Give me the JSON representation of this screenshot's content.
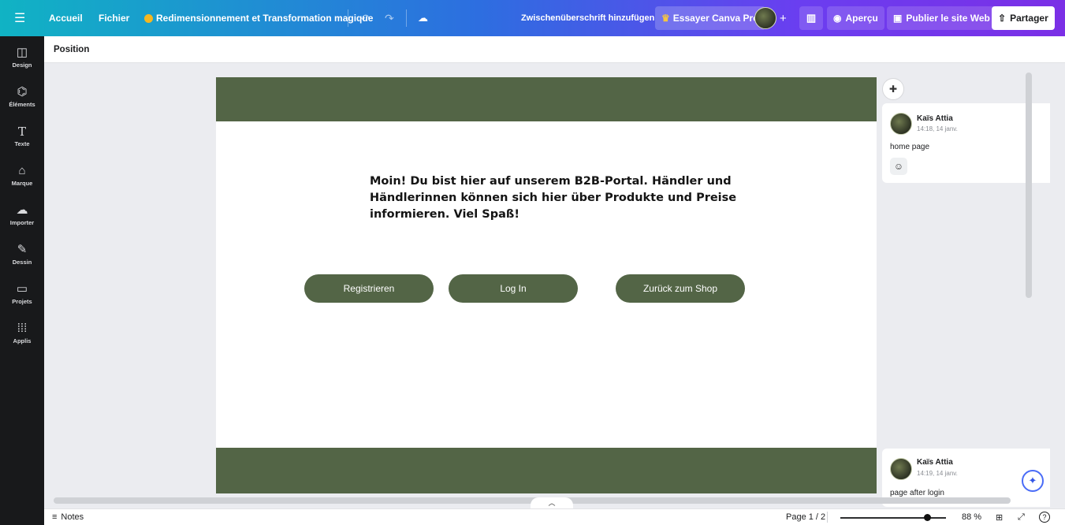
{
  "topbar": {
    "menu_icon": "hamburger-icon",
    "home": "Accueil",
    "file": "Fichier",
    "magic": "Redimensionnement et Transformation magique",
    "subtitle_action": "Zwischenüberschrift hinzufügen",
    "pro": "Essayer Canva Pro",
    "preview": "Aperçu",
    "publish": "Publier le site Web",
    "share": "Partager"
  },
  "sidebar": {
    "items": [
      {
        "label": "Design",
        "icon": "layout-icon"
      },
      {
        "label": "Éléments",
        "icon": "shapes-icon"
      },
      {
        "label": "Texte",
        "icon": "text-icon"
      },
      {
        "label": "Marque",
        "icon": "brand-icon"
      },
      {
        "label": "Importer",
        "icon": "upload-icon"
      },
      {
        "label": "Dessin",
        "icon": "draw-icon"
      },
      {
        "label": "Projets",
        "icon": "folder-icon"
      },
      {
        "label": "Applis",
        "icon": "apps-icon"
      }
    ]
  },
  "panel": {
    "title": "Position"
  },
  "page": {
    "heading": "Moin! Du bist hier auf unserem B2B-Portal. Händler und Händlerinnen können sich hier über Produkte und Preise informieren. Viel Spaß!",
    "buttons": [
      "Registrieren",
      "Log In",
      "Zurück zum Shop"
    ],
    "accent": "#536546"
  },
  "comments": [
    {
      "author": "Kaïs Attia",
      "time": "14:18, 14 janv.",
      "text": "home page"
    },
    {
      "author": "Kaïs Attia",
      "time": "14:19, 14 janv.",
      "text": "page after login"
    }
  ],
  "footer": {
    "notes": "Notes",
    "page": "Page 1 / 2",
    "zoom": "88 %",
    "zoom_fraction": 0.82
  }
}
